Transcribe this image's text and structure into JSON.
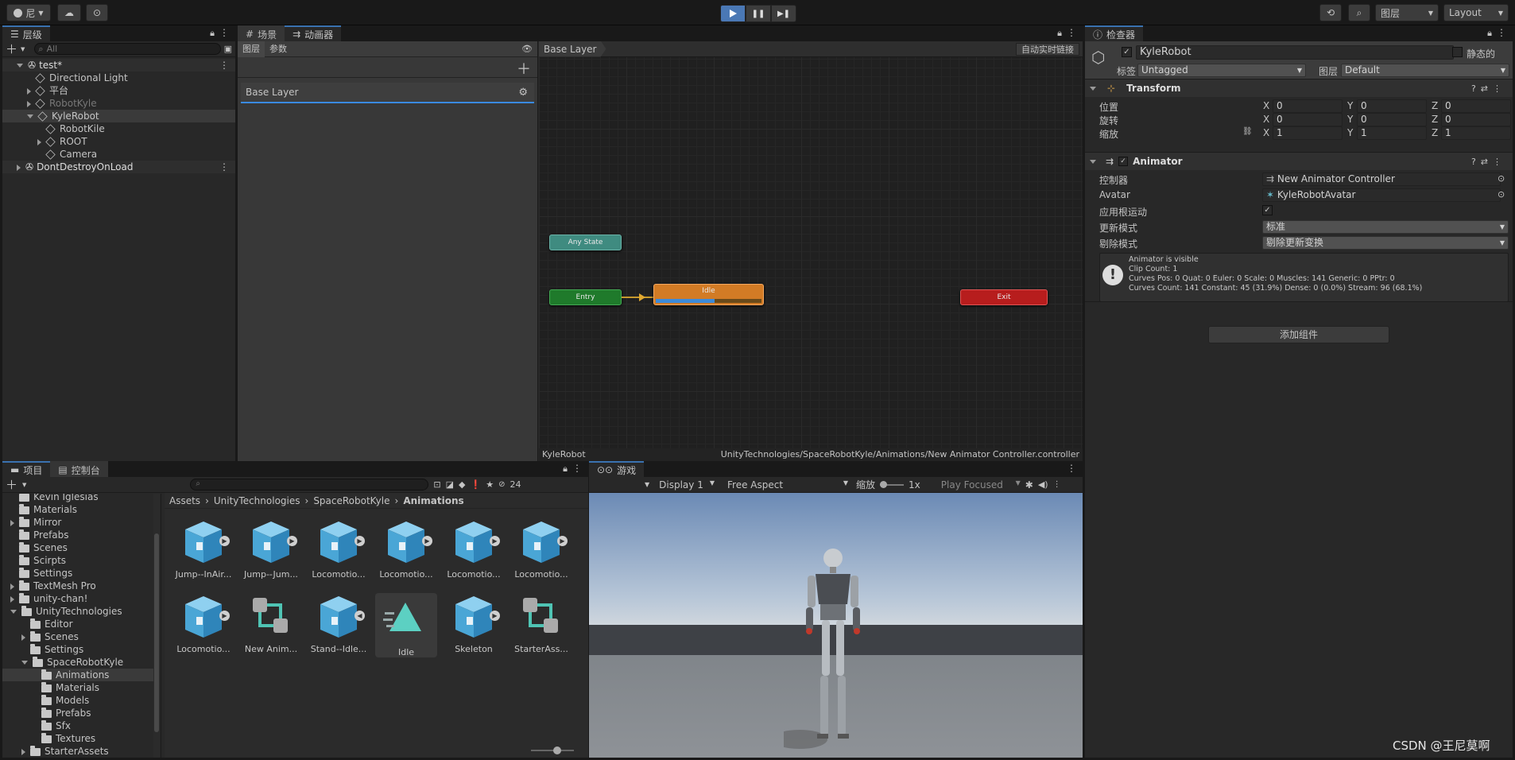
{
  "toolbar": {
    "account": "尼",
    "layers": "图层",
    "layout": "Layout"
  },
  "hierarchy": {
    "tab": "层级",
    "search_placeholder": "All",
    "items": [
      {
        "label": "test*",
        "kind": "scene",
        "depth": 0,
        "expanded": true
      },
      {
        "label": "Directional Light",
        "kind": "object",
        "depth": 1
      },
      {
        "label": "平台",
        "kind": "object",
        "depth": 1,
        "expandable": true
      },
      {
        "label": "RobotKyle",
        "kind": "object",
        "depth": 1,
        "expandable": true,
        "disabled": true
      },
      {
        "label": "KyleRobot",
        "kind": "object",
        "depth": 1,
        "expanded": true,
        "selected": true
      },
      {
        "label": "RobotKile",
        "kind": "object",
        "depth": 2
      },
      {
        "label": "ROOT",
        "kind": "object",
        "depth": 2,
        "expandable": true
      },
      {
        "label": "Camera",
        "kind": "object",
        "depth": 2
      },
      {
        "label": "DontDestroyOnLoad",
        "kind": "scene",
        "depth": 0,
        "expandable": true
      }
    ]
  },
  "animator": {
    "tab_scene": "场景",
    "tab_animator": "动画器",
    "tab_layers": "图层",
    "tab_params": "参数",
    "breadcrumb": "Base Layer",
    "auto_link": "自动实时链接",
    "layer_name": "Base Layer",
    "states": {
      "any": "Any State",
      "entry": "Entry",
      "idle": "Idle",
      "exit": "Exit"
    },
    "footer_left": "KyleRobot",
    "footer_right": "UnityTechnologies/SpaceRobotKyle/Animations/New Animator Controller.controller"
  },
  "inspector": {
    "tab": "检查器",
    "object_name": "KyleRobot",
    "static_label": "静态的",
    "tag_label": "标签",
    "tag_value": "Untagged",
    "layer_label": "图层",
    "layer_value": "Default",
    "transform": {
      "title": "Transform",
      "pos_label": "位置",
      "rot_label": "旋转",
      "scale_label": "缩放",
      "x": "X",
      "y": "Y",
      "z": "Z",
      "pos": [
        "0",
        "0",
        "0"
      ],
      "rot": [
        "0",
        "0",
        "0"
      ],
      "scale": [
        "1",
        "1",
        "1"
      ]
    },
    "animator": {
      "title": "Animator",
      "controller_label": "控制器",
      "controller_value": "New Animator Controller",
      "avatar_label": "Avatar",
      "avatar_value": "KyleRobotAvatar",
      "root_motion_label": "应用根运动",
      "update_label": "更新模式",
      "update_value": "标准",
      "culling_label": "剔除模式",
      "culling_value": "剔除更新变换",
      "info": [
        "Animator is visible",
        "Clip Count: 1",
        "Curves Pos: 0 Quat: 0 Euler: 0 Scale: 0 Muscles: 141 Generic: 0 PPtr: 0",
        "Curves Count: 141 Constant: 45 (31.9%) Dense: 0 (0.0%) Stream: 96 (68.1%)"
      ]
    },
    "add_component": "添加组件"
  },
  "project": {
    "tab_project": "项目",
    "tab_console": "控制台",
    "hidden_count": "24",
    "tree": [
      {
        "label": "Kevin Iglesias",
        "depth": 1
      },
      {
        "label": "Materials",
        "depth": 1
      },
      {
        "label": "Mirror",
        "depth": 1,
        "expandable": true
      },
      {
        "label": "Prefabs",
        "depth": 1
      },
      {
        "label": "Scenes",
        "depth": 1
      },
      {
        "label": "Scirpts",
        "depth": 1
      },
      {
        "label": "Settings",
        "depth": 1
      },
      {
        "label": "TextMesh Pro",
        "depth": 1,
        "expandable": true
      },
      {
        "label": "unity-chan!",
        "depth": 1,
        "expandable": true
      },
      {
        "label": "UnityTechnologies",
        "depth": 1,
        "expanded": true
      },
      {
        "label": "Editor",
        "depth": 2
      },
      {
        "label": "Scenes",
        "depth": 2,
        "expandable": true
      },
      {
        "label": "Settings",
        "depth": 2
      },
      {
        "label": "SpaceRobotKyle",
        "depth": 2,
        "expanded": true
      },
      {
        "label": "Animations",
        "depth": 3,
        "selected": true
      },
      {
        "label": "Materials",
        "depth": 3
      },
      {
        "label": "Models",
        "depth": 3
      },
      {
        "label": "Prefabs",
        "depth": 3
      },
      {
        "label": "Sfx",
        "depth": 3
      },
      {
        "label": "Textures",
        "depth": 3
      },
      {
        "label": "StarterAssets",
        "depth": 2,
        "expandable": true
      }
    ],
    "breadcrumb": [
      "Assets",
      "UnityTechnologies",
      "SpaceRobotKyle",
      "Animations"
    ],
    "assets": [
      {
        "label": "Jump--InAir...",
        "kind": "box"
      },
      {
        "label": "Jump--Jum...",
        "kind": "box"
      },
      {
        "label": "Locomotio...",
        "kind": "box"
      },
      {
        "label": "Locomotio...",
        "kind": "box"
      },
      {
        "label": "Locomotio...",
        "kind": "box"
      },
      {
        "label": "Locomotio...",
        "kind": "box"
      },
      {
        "label": "Locomotio...",
        "kind": "box"
      },
      {
        "label": "New Anim...",
        "kind": "controller"
      },
      {
        "label": "Stand--Idle...",
        "kind": "box-open"
      },
      {
        "label": "Idle",
        "kind": "clip"
      },
      {
        "label": "Skeleton",
        "kind": "box"
      },
      {
        "label": "StarterAss...",
        "kind": "controller"
      }
    ]
  },
  "game": {
    "tab": "游戏",
    "display": "Display 1",
    "aspect": "Free Aspect",
    "scale_label": "缩放",
    "scale_value": "1x",
    "play_mode": "Play Focused"
  },
  "watermark": "CSDN @王尼莫啊",
  "colors": {
    "accent": "#3a72b0",
    "idle": "#d27b25",
    "entry": "#1f7a2b",
    "any": "#3f8b80",
    "exit": "#b71d1d"
  }
}
